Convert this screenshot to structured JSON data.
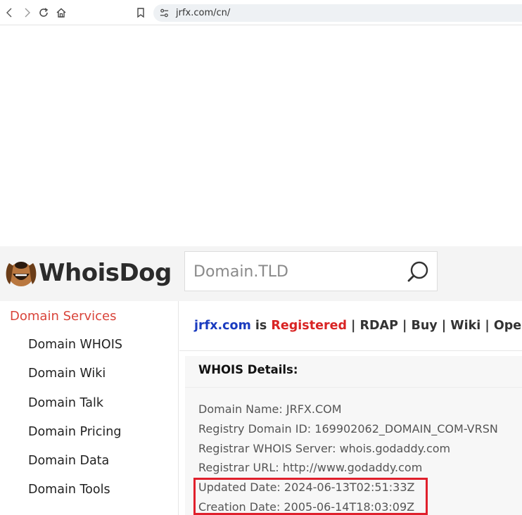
{
  "browser": {
    "url": "jrfx.com/cn/"
  },
  "site": {
    "brand": "WhoisDog",
    "search": {
      "placeholder": "Domain.TLD"
    }
  },
  "sidebar": {
    "section_title": "Domain Services",
    "items": [
      {
        "label": "Domain WHOIS"
      },
      {
        "label": "Domain Wiki"
      },
      {
        "label": "Domain Talk"
      },
      {
        "label": "Domain Pricing"
      },
      {
        "label": "Domain Data"
      },
      {
        "label": "Domain Tools"
      }
    ]
  },
  "main": {
    "status": {
      "domain": "jrfx.com",
      "is": " is ",
      "state": "Registered",
      "links": [
        {
          "label": "RDAP"
        },
        {
          "label": "Buy"
        },
        {
          "label": "Wiki"
        },
        {
          "label": "Open"
        }
      ],
      "separator": " | "
    },
    "whois": {
      "heading": "WHOIS Details:",
      "lines": [
        "Domain Name: JRFX.COM",
        "Registry Domain ID: 169902062_DOMAIN_COM-VRSN",
        "Registrar WHOIS Server: whois.godaddy.com",
        "Registrar URL: http://www.godaddy.com",
        "Updated Date: 2024-06-13T02:51:33Z",
        "Creation Date: 2005-06-14T18:03:09Z"
      ]
    }
  },
  "colors": {
    "accent_red": "#d9443a",
    "domain_blue": "#1a3bbf",
    "highlight_border": "#e0202c"
  }
}
